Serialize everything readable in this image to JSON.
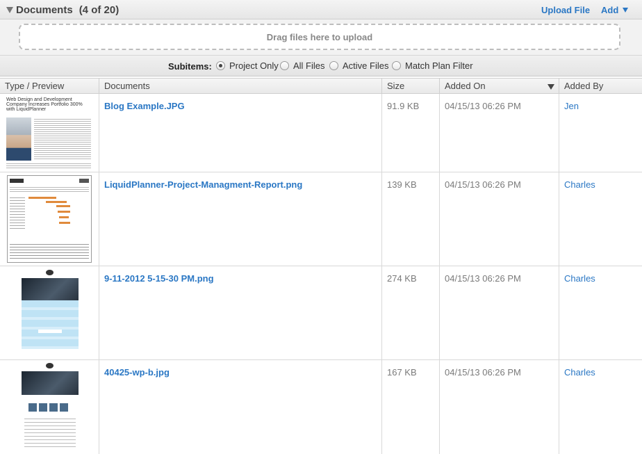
{
  "header": {
    "title": "Documents",
    "count": "(4 of 20)",
    "upload_label": "Upload File",
    "add_label": "Add"
  },
  "dropzone": {
    "text": "Drag files here to upload"
  },
  "filter": {
    "label": "Subitems:",
    "options": [
      "Project Only",
      "All Files",
      "Active Files",
      "Match Plan Filter"
    ],
    "selected": "Project Only"
  },
  "table": {
    "columns": [
      "Type / Preview",
      "Documents",
      "Size",
      "Added On",
      "Added By"
    ],
    "sorted_column": "Added On",
    "rows": [
      {
        "name": "Blog Example.JPG",
        "size": "91.9 KB",
        "added_on": "04/15/13 06:26 PM",
        "added_by": "Jen",
        "preview_title": "Web Design and Development Company Increases Portfolio 300% with LiquidPlanner"
      },
      {
        "name": "LiquidPlanner-Project-Managment-Report.png",
        "size": "139 KB",
        "added_on": "04/15/13 06:26 PM",
        "added_by": "Charles"
      },
      {
        "name": "9-11-2012 5-15-30 PM.png",
        "size": "274 KB",
        "added_on": "04/15/13 06:26 PM",
        "added_by": "Charles"
      },
      {
        "name": "40425-wp-b.jpg",
        "size": "167 KB",
        "added_on": "04/15/13 06:26 PM",
        "added_by": "Charles"
      }
    ]
  },
  "colors": {
    "link": "#2a77c4",
    "header_bg": "#e6e6e6",
    "border": "#d8d8d8"
  }
}
